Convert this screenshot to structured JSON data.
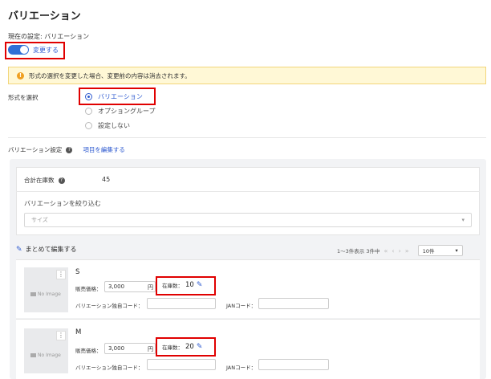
{
  "page": {
    "title": "バリエーション",
    "current_setting": "現在の設定: バリエーション"
  },
  "toggle": {
    "label": "変更する",
    "on": true
  },
  "warning": {
    "text": "形式の選択を変更した場合、変更前の内容は消去されます。"
  },
  "format": {
    "label": "形式を選択",
    "options": [
      {
        "label": "バリエーション",
        "selected": true
      },
      {
        "label": "オプショングループ",
        "selected": false
      },
      {
        "label": "設定しない",
        "selected": false
      }
    ]
  },
  "variation_setting": {
    "label": "バリエーション設定",
    "edit_link": "項目を編集する"
  },
  "summary": {
    "total_stock_label": "合計在庫数",
    "total_stock_value": "45",
    "filter_label": "バリエーションを絞り込む",
    "filter_placeholder": "サイズ"
  },
  "toolbar": {
    "bulk_edit": "まとめて編集する",
    "range_text": "1〜3件表示 3件中",
    "per_page": "10件"
  },
  "labels": {
    "price": "販売価格：",
    "yen": "円",
    "stock": "在庫数：",
    "unique_code": "バリエーション独自コード：",
    "jan_code": "JANコード：",
    "no_image": "No Image"
  },
  "variants": [
    {
      "name": "S",
      "price": "3,000",
      "stock": "10"
    },
    {
      "name": "M",
      "price": "3,000",
      "stock": "20"
    }
  ],
  "colors": {
    "accent": "#2f5bd0",
    "highlight": "#e00000",
    "warning_bg": "#fff8d6"
  }
}
